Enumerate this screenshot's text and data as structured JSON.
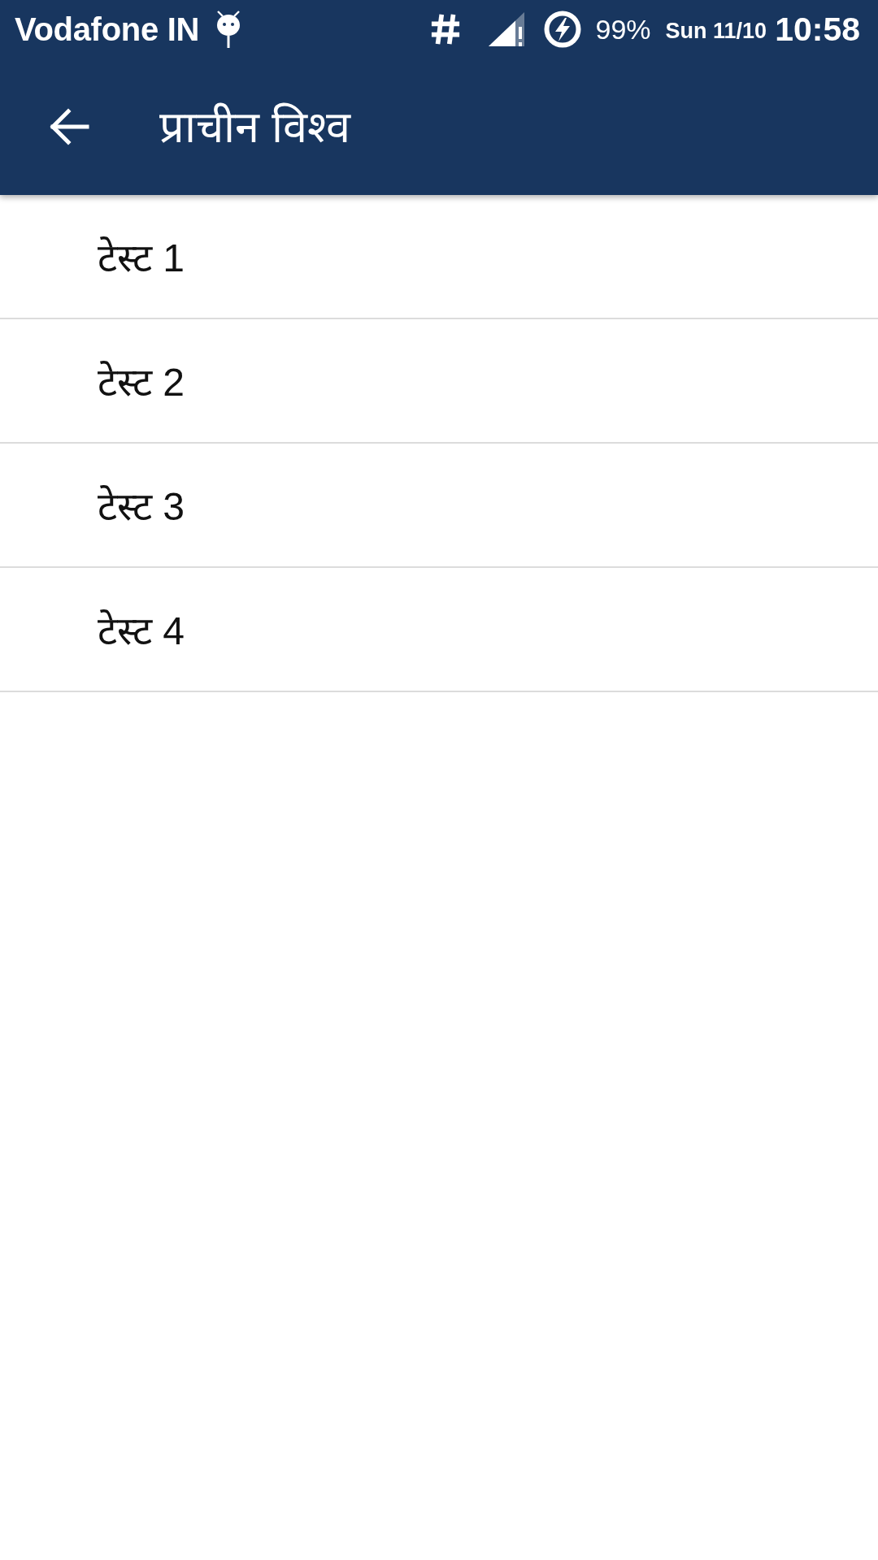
{
  "status_bar": {
    "carrier": "Vodafone IN",
    "battery_percent": "99%",
    "date": "Sun 11/10",
    "time": "10:58"
  },
  "app_bar": {
    "title": "प्राचीन विश्व"
  },
  "list": {
    "items": [
      {
        "label": "टेस्ट 1"
      },
      {
        "label": "टेस्ट 2"
      },
      {
        "label": "टेस्ट 3"
      },
      {
        "label": "टेस्ट 4"
      }
    ]
  }
}
